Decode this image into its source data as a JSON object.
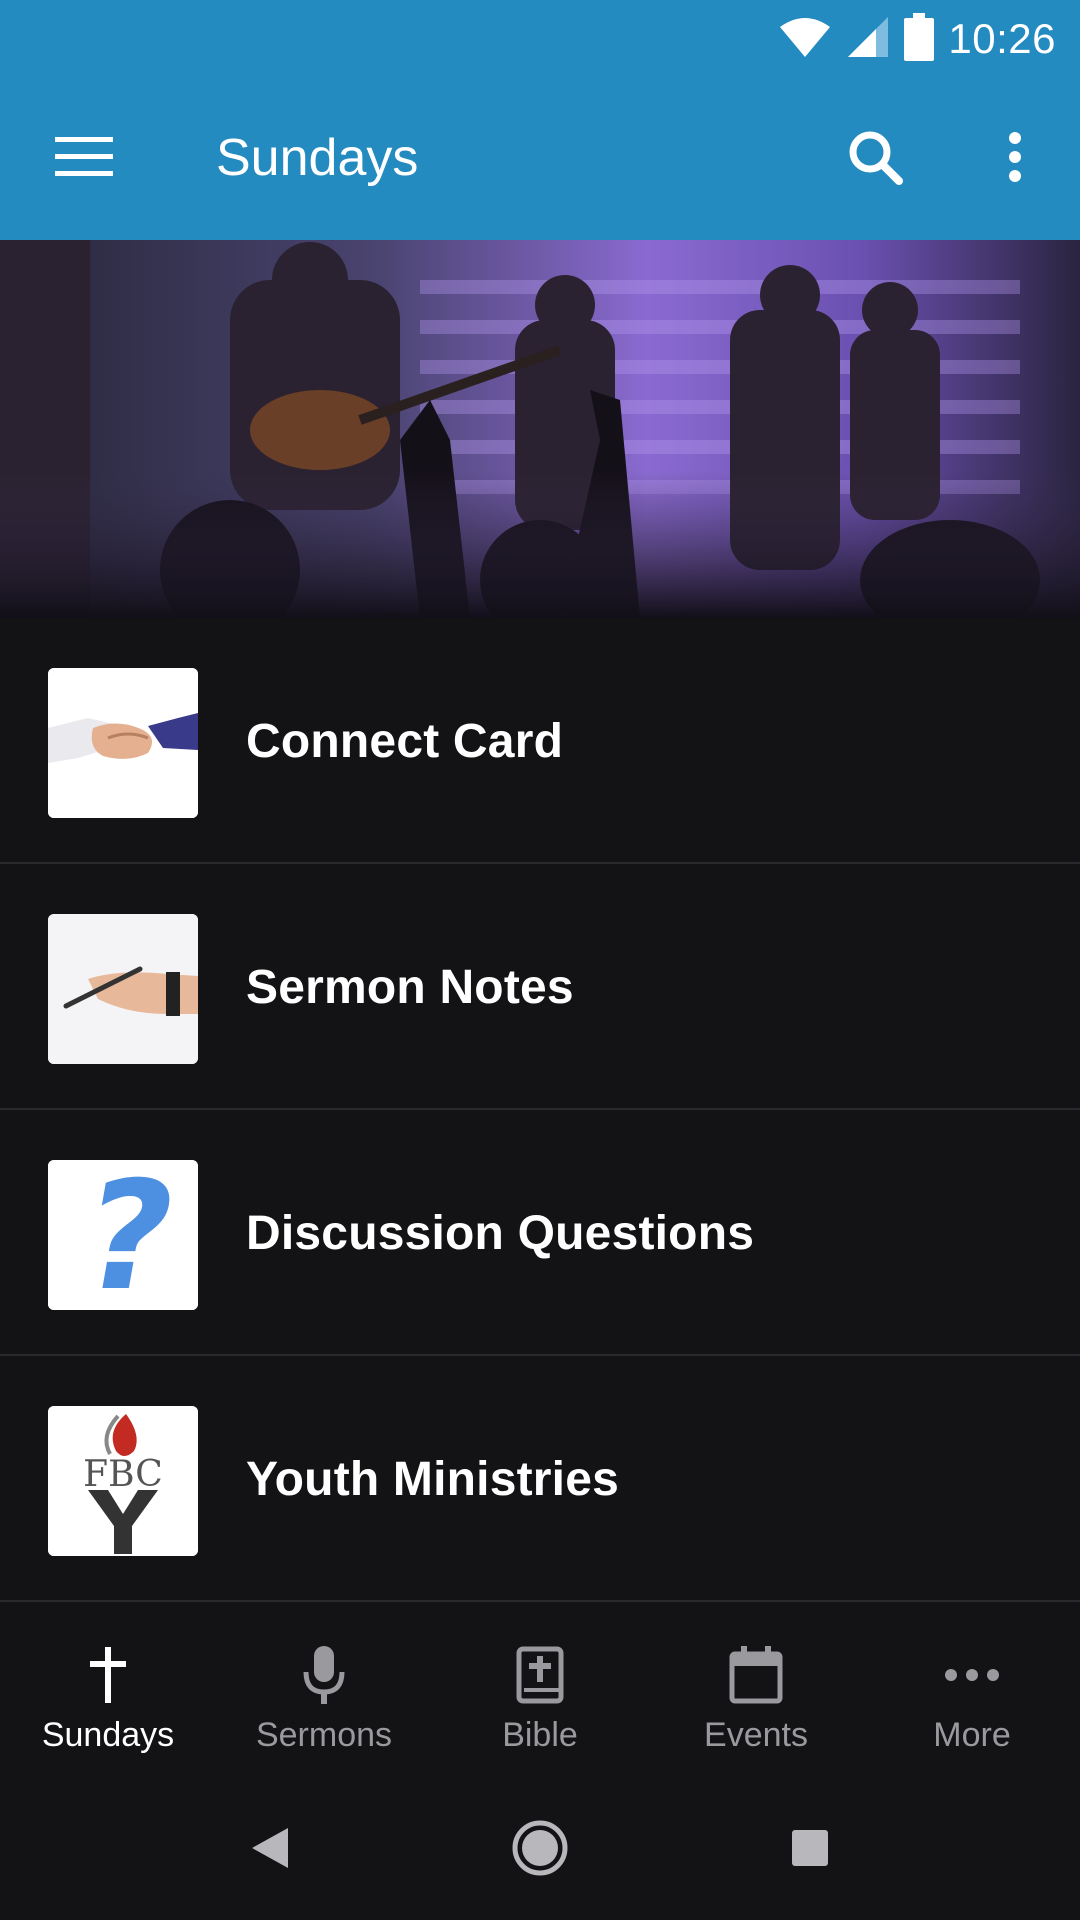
{
  "status_bar": {
    "time": "10:26",
    "icons": [
      "wifi-icon",
      "signal-icon",
      "battery-icon"
    ]
  },
  "app_bar": {
    "title": "Sundays",
    "menu_icon": "hamburger-menu-icon",
    "search_icon": "search-icon",
    "overflow_icon": "more-vertical-icon",
    "color": "#238bc0"
  },
  "hero": {
    "image": "worship-band-photo"
  },
  "list": {
    "items": [
      {
        "label": "Connect Card",
        "thumbnail": "handshake-image"
      },
      {
        "label": "Sermon Notes",
        "thumbnail": "hand-writing-image"
      },
      {
        "label": "Discussion Questions",
        "thumbnail": "question-mark-image"
      },
      {
        "label": "Youth Ministries",
        "thumbnail": "fbc-youth-logo",
        "logo_text": "FBC"
      }
    ]
  },
  "bottom_nav": {
    "items": [
      {
        "label": "Sundays",
        "icon": "cross-icon",
        "active": true
      },
      {
        "label": "Sermons",
        "icon": "microphone-icon",
        "active": false
      },
      {
        "label": "Bible",
        "icon": "bible-icon",
        "active": false
      },
      {
        "label": "Events",
        "icon": "calendar-icon",
        "active": false
      },
      {
        "label": "More",
        "icon": "more-horizontal-icon",
        "active": false
      }
    ]
  },
  "system_nav": {
    "icons": [
      "back-icon",
      "home-icon",
      "recents-icon"
    ]
  },
  "colors": {
    "background": "#131316",
    "inactive": "#9a9a9e",
    "active": "#ffffff"
  }
}
